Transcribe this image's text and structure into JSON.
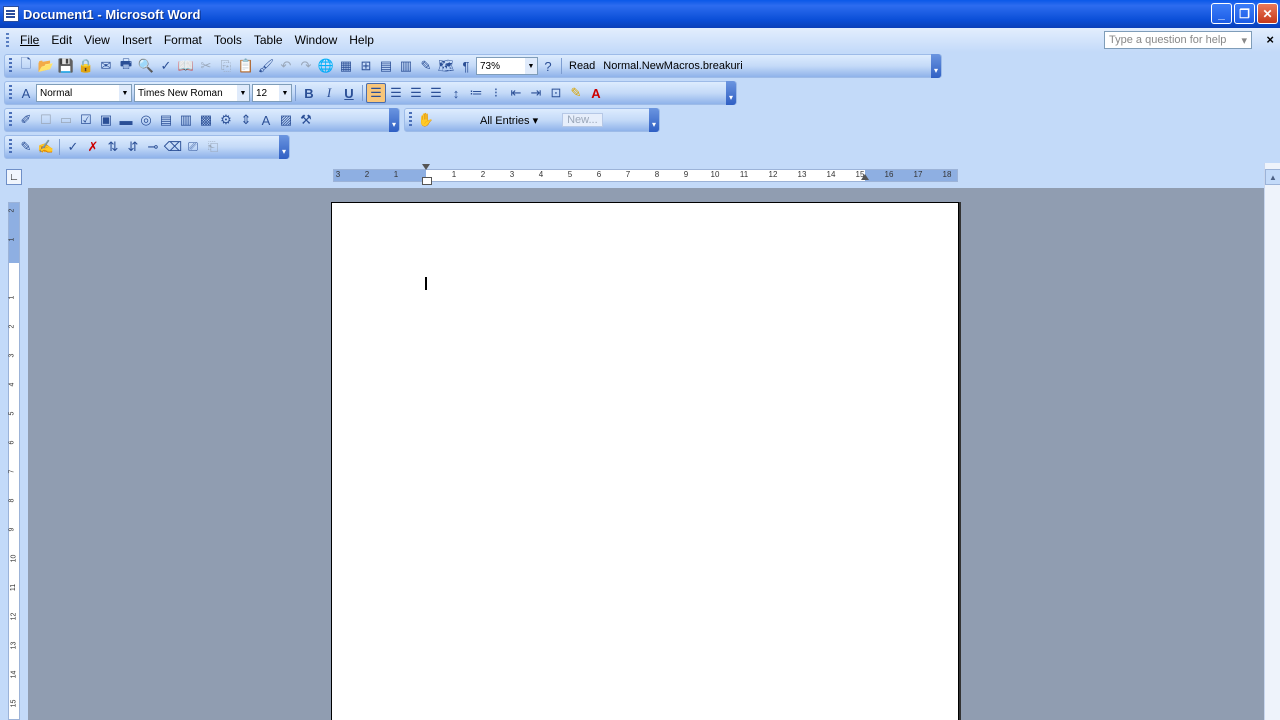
{
  "window": {
    "title": "Document1 - Microsoft Word",
    "min": "_",
    "max": "❐",
    "close": "✕"
  },
  "menu": {
    "items": [
      "File",
      "Edit",
      "View",
      "Insert",
      "Format",
      "Tools",
      "Table",
      "Window",
      "Help"
    ],
    "help_placeholder": "Type a question for help",
    "close_doc": "×"
  },
  "standard": {
    "zoom": "73%",
    "read": "Read",
    "macro": "Normal.NewMacros.breakuri"
  },
  "formatting": {
    "style": "Normal",
    "font": "Times New Roman",
    "size": "12",
    "bold": "B",
    "italic": "I",
    "underline": "U"
  },
  "autotext": {
    "all_entries": "All Entries ▾",
    "new": "New..."
  },
  "ruler": {
    "labels": [
      "3",
      "2",
      "1",
      "",
      "1",
      "2",
      "3",
      "4",
      "5",
      "6",
      "7",
      "8",
      "9",
      "10",
      "11",
      "12",
      "13",
      "14",
      "15",
      "16",
      "17",
      "18"
    ]
  },
  "vruler": {
    "labels": [
      "2",
      "1",
      "",
      "1",
      "2",
      "3",
      "4",
      "5",
      "6",
      "7",
      "8",
      "9",
      "10",
      "11",
      "12",
      "13",
      "14",
      "15"
    ]
  }
}
